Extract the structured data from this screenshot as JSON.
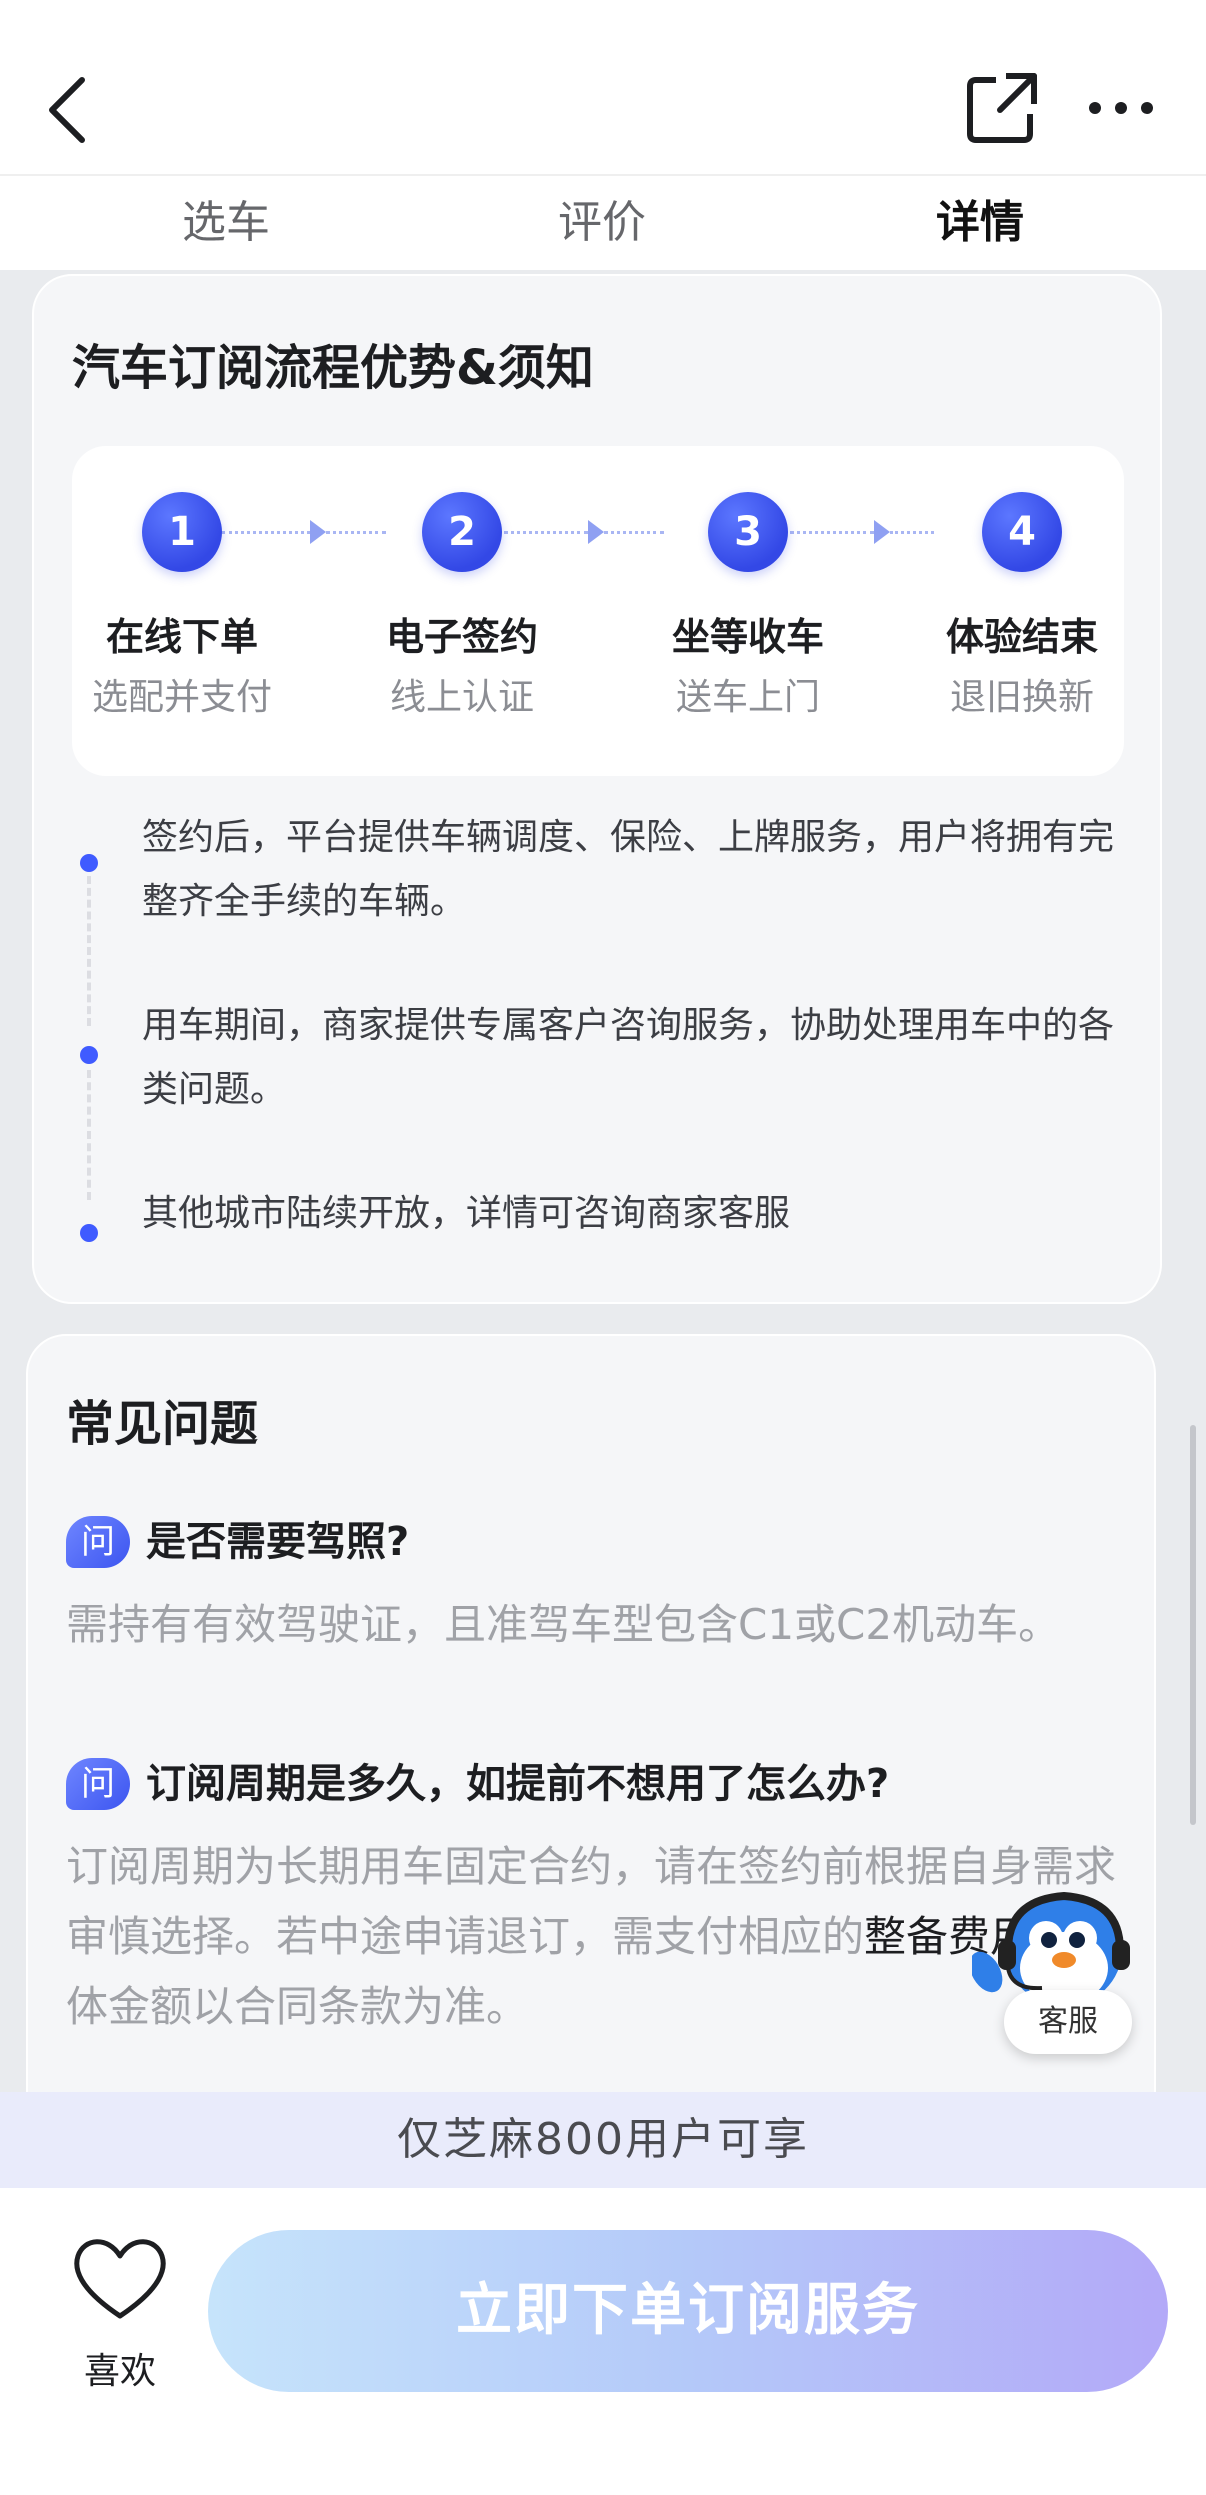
{
  "tabs": [
    {
      "label": "选车"
    },
    {
      "label": "评价"
    },
    {
      "label": "详情"
    }
  ],
  "process": {
    "title": "汽车订阅流程优势&须知",
    "steps": [
      {
        "num": "1",
        "title": "在线下单",
        "sub": "选配并支付"
      },
      {
        "num": "2",
        "title": "电子签约",
        "sub": "线上认证"
      },
      {
        "num": "3",
        "title": "坐等收车",
        "sub": "送车上门"
      },
      {
        "num": "4",
        "title": "体验结束",
        "sub": "退旧换新"
      }
    ],
    "bullets": [
      {
        "text": "签约后，平台提供车辆调度、保险、上牌服务，用户将拥有完整齐全手续的车辆。"
      },
      {
        "text": "用车期间，商家提供专属客户咨询服务，协助处理用车中的各类问题。"
      },
      {
        "text": "其他城市陆续开放，详情可咨询商家客服"
      }
    ]
  },
  "faq": {
    "title": "常见问题",
    "badge": "问",
    "items": [
      {
        "q": "是否需要驾照?",
        "a": "需持有有效驾驶证，且准驾车型包含C1或C2机动车。"
      },
      {
        "q": "订阅周期是多久，如提前不想用了怎么办?",
        "a": "订阅周期为长期用车固定合约，请在签约前根据自身需求审慎选择。若中途申请退订，需支付相应的",
        "a_dark": "整备费用",
        "a_tail": "，具体金额以合同条款为准。"
      }
    ]
  },
  "service": {
    "label": "客服"
  },
  "zhima_notice": "仅芝麻800用户可享",
  "bottom": {
    "like_label": "喜欢",
    "order_label": "立即下单订阅服务"
  },
  "colors": {
    "accent": "#3f5bff",
    "page_bg": "#e9ebee"
  }
}
